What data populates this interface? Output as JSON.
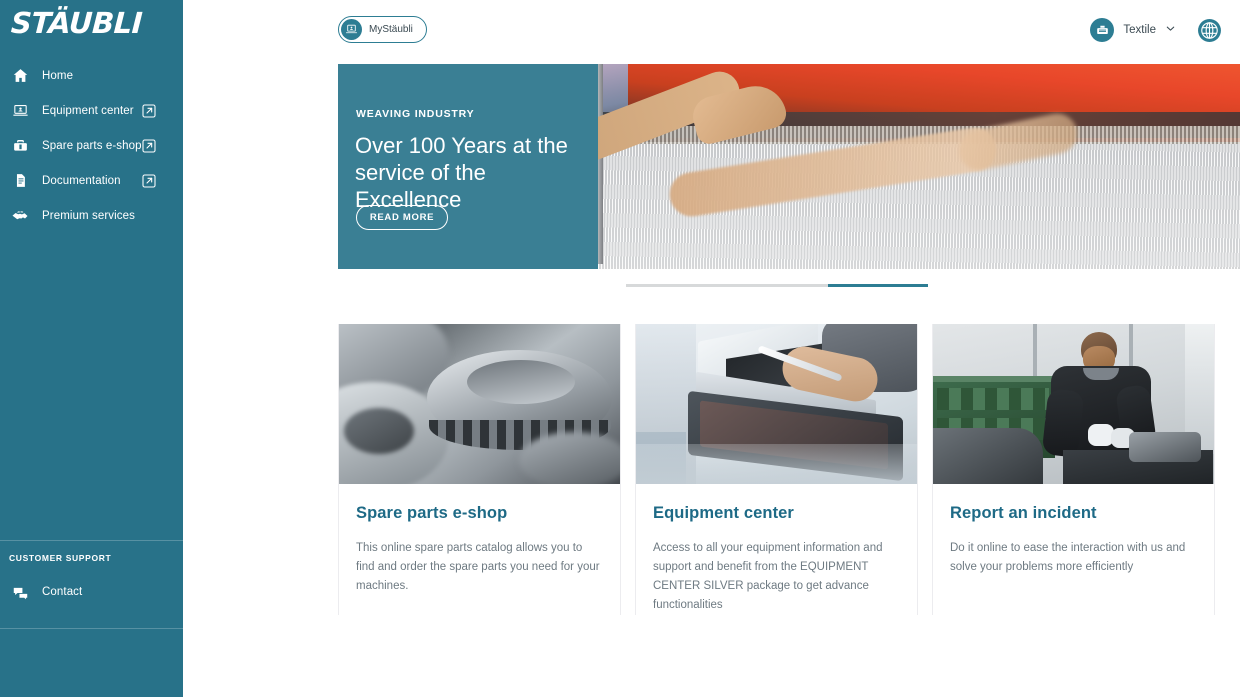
{
  "brand": {
    "logo_text": "STÄUBLI",
    "accent_color": "#287289",
    "panel_color": "#3a7f94",
    "link_color": "#1e6a86"
  },
  "sidebar": {
    "items": [
      {
        "label": "Home",
        "icon": "home-icon",
        "external": false
      },
      {
        "label": "Equipment center",
        "icon": "monitor-icon",
        "external": true
      },
      {
        "label": "Spare parts e-shop",
        "icon": "toolbox-icon",
        "external": true
      },
      {
        "label": "Documentation",
        "icon": "document-icon",
        "external": true
      },
      {
        "label": "Premium services",
        "icon": "handshake-icon",
        "external": false
      }
    ],
    "support": {
      "title": "CUSTOMER SUPPORT",
      "contact_label": "Contact",
      "contact_icon": "chat-bubble-icon"
    }
  },
  "topbar": {
    "mystaubli_label": "MyStäubli",
    "mystaubli_icon": "mystaubli-icon",
    "sector_label": "Textile",
    "sector_icon": "textile-icon",
    "chevron_icon": "chevron-down-icon",
    "language_icon": "globe-icon"
  },
  "hero": {
    "kicker": "WEAVING INDUSTRY",
    "title": "Over 100 Years at the service of the Excellence",
    "button_label": "READ MORE",
    "carousel": {
      "total_slides": 3,
      "active_slide": 3
    }
  },
  "cards": [
    {
      "title": "Spare parts e-shop",
      "text": "This online spare parts catalog allows you to find and order the spare parts you need for your machines.",
      "image": "metal-gears-photo"
    },
    {
      "title": "Equipment center",
      "text": "Access to all your equipment information and support and benefit from the EQUIPMENT CENTER SILVER package to get advance functionalities",
      "image": "laptop-tablet-photo"
    },
    {
      "title": "Report an incident",
      "text": "Do it online to ease the interaction with us and solve your problems more efficiently",
      "image": "technician-workshop-photo"
    }
  ]
}
